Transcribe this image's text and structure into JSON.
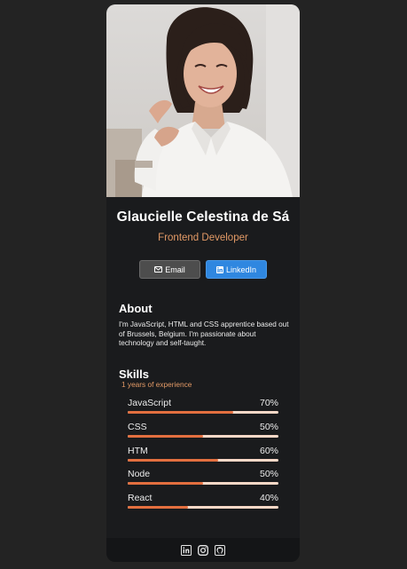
{
  "profile": {
    "name": "Glaucielle Celestina de Sá",
    "role": "Frontend Developer",
    "photo_alt": "profile-photo"
  },
  "buttons": {
    "email_label": "Email",
    "linkedin_label": "LinkedIn"
  },
  "about": {
    "title": "About",
    "text": "I'm JavaScript, HTML and CSS apprentice based out of Brussels, Belgium. I'm passionate about technology and self-taught."
  },
  "skills": {
    "title": "Skills",
    "experience": "1 years of experience",
    "items": [
      {
        "name": "JavaScript",
        "percent_label": "70%",
        "level": 0.7
      },
      {
        "name": "CSS",
        "percent_label": "50%",
        "level": 0.5
      },
      {
        "name": "HTM",
        "percent_label": "60%",
        "level": 0.6
      },
      {
        "name": "Node",
        "percent_label": "50%",
        "level": 0.5
      },
      {
        "name": "React",
        "percent_label": "40%",
        "level": 0.4
      }
    ]
  },
  "footer": {
    "icons": [
      "linkedin-icon",
      "instagram-icon",
      "github-icon"
    ]
  },
  "colors": {
    "page_background": "#232323",
    "card_background": "#1a1b1d",
    "accent": "#e39a66",
    "bar_fill": "#e36f3f",
    "bar_track": "#f8d8c7",
    "linkedin_blue": "#2f87e0",
    "email_gray": "#4d4d4d"
  }
}
